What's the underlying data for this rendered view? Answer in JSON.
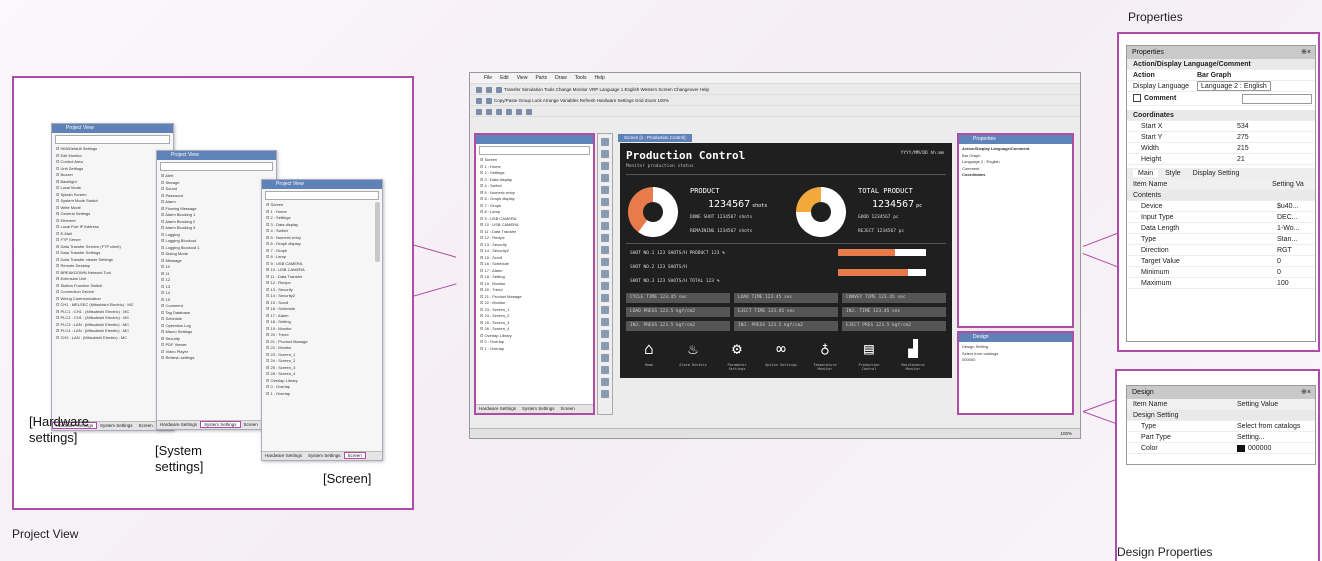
{
  "colors": {
    "accent": "#b04ca8",
    "window_title_bar": "#5f83b8",
    "hmi_background": "#1f1f1f",
    "orange": "#e87b4c",
    "yellow_orange": "#f2a93b"
  },
  "labels": {
    "properties": "Properties",
    "project_view": "Project View",
    "design_properties": "Design Properties",
    "hardware_settings": "[Hardware\nsettings]",
    "system_settings": "[System\nsettings]",
    "screen": "[Screen]"
  },
  "hardware_win": {
    "title": "Project View",
    "items": [
      "HMI/Default Settings",
      "Edit Monitor",
      "Control Area",
      "Unit Settings",
      "Buzzer",
      "Backlight",
      "Local Mode",
      "Splash Screen",
      "System Mode Switch",
      "Write Mode",
      "General Settings",
      "Ethernet",
      "Local Port IP Address",
      "E-Mail",
      "FTP Server",
      "Data Transfer Service (FTP client)",
      "Data Transfer Settings",
      "Data Transfer viewer Settings",
      "Remote Desktop",
      "BREAKDOWN Network Tool",
      "Extension Unit",
      "Station Function Switch",
      "Connection Device",
      "Wiring Communication",
      "CH1 : MELSEC (Mitsubishi Electric) : MC",
      "PLC1 : CH1 : (Mitsubishi Electric) : MC",
      "PLC2 : CH1 : (Mitsubishi Electric) : MC",
      "PLC3 : LAN : (Mitsubishi Electric) : MC",
      "PLC4 : LAN : (Mitsubishi Electric) : MC",
      "CH2 : LAN : (Mitsubishi Electric) : MC"
    ],
    "tabs": [
      "Hardware Settings",
      "System Settings",
      "Screen"
    ]
  },
  "system_win": {
    "title": "Project View",
    "items": [
      "Alert",
      "Storage",
      "Sound",
      "Password",
      "Alarm",
      "Flowing Message",
      "Alarm Blocking 1",
      "Alarm Blocking 2",
      "Alarm Blocking 3",
      "Logging",
      "Logging Blockout",
      "Logging Blockout 1",
      "Dialog Mode",
      "Message",
      "10",
      "11",
      "12",
      "13",
      "14",
      "15",
      "Comment",
      "Tag Database",
      "Schedule",
      "Operation Log",
      "Macro Settings",
      "Security",
      "PDF Viewer",
      "Video Player",
      "Refresh settings"
    ],
    "tabs": [
      "Hardware Settings",
      "System Settings",
      "Screen"
    ]
  },
  "screen_win": {
    "title": "Project View",
    "items": [
      "Screen",
      "1 : Home",
      "2 : Settings",
      "3 : Data display",
      "4 : Switch",
      "5 : Numeric entry",
      "6 : Graph display",
      "7 : Graph",
      "8 : Lamp",
      "9 : USB CAMERA",
      "10 : USB CAMERA",
      "11 : Data Transfer",
      "12 : Recipe",
      "13 : Security",
      "14 : Security2",
      "15 : Scroll",
      "16 : Schedule",
      "17 : Alarm",
      "18 : Setting",
      "19 : Monitor",
      "20 : Trend",
      "21 : Product Manage",
      "22 : Monitor",
      "23 : Screen_1",
      "24 : Screen_2",
      "25 : Screen_3",
      "26 : Screen_4",
      "Overlap Library",
      "0 : Overlap",
      "1 : Overlap"
    ],
    "tabs": [
      "Hardware Settings",
      "System Settings",
      "Screen"
    ]
  },
  "app": {
    "menu": [
      "File",
      "Edit",
      "View",
      "Parts",
      "Draw",
      "Tools",
      "Help"
    ],
    "toolbar1": "Transfer  Simulation  Tools  Change Monitor  VRP  Language 1 English Western  Screen Changeover  Help",
    "toolbar2": "Copy/Paste  Group  Lock  Arrange  Variables  Refresh  Hardware Settings  Grid  Zoom  100%",
    "project_tabs": [
      "Hardware Settings",
      "System Settings",
      "Screen"
    ],
    "screen_tab": "Screen [1 : Production Control]",
    "status_right": "100%"
  },
  "hmi": {
    "title": "Production Control",
    "subtitle": "Monitor production status",
    "timestamp": "YYYY/MM/DD hh:mm",
    "product_label": "PRODUCT",
    "total_label": "TOTAL PRODUCT",
    "product_value": "1234567",
    "product_unit": "shots",
    "total_value": "1234567",
    "total_unit": "pc",
    "small_rows": [
      "DONE SHOT  1234567  shots",
      "REMAINING  1234567  shots",
      "GOOD  1234567  pc",
      "REJECT  1234567  pc"
    ],
    "shot_rows": [
      "SHOT NO.1  123  SHOTS/H  PRODUCT  123 %",
      "SHOT NO.2  123  SHOTS/H",
      "SHOT NO.3  123  SHOTS/H  TOTAL  123 %"
    ],
    "time_cells": [
      "CYCLE TIME  123.45 sec",
      "LOAD TIME  123.45 sec",
      "CONVEY TIME  123.45 sec",
      "LOAD PRESS  123.5 kgf/cm2",
      "EJECT TIME  123.45 sec",
      "INJ. TIME  123.45 sec",
      "INJ. PRESS  123.5 kgf/cm2",
      "INJ. PRESS  123.5 kgf/cm2",
      "EJECT PRES  123.5 kgf/cm2"
    ],
    "product_fraction": 0.6,
    "total_fraction": 0.75,
    "bar1_fraction": 0.65,
    "bar2_fraction": 0.8,
    "nav_icons": [
      "home-icon",
      "alarm-icon",
      "settings-icon",
      "search-icon",
      "temperature-icon",
      "production-icon",
      "factory-icon"
    ],
    "nav_labels": [
      "Home",
      "Alarm History",
      "Parameter Settings",
      "Option Settings",
      "Temperature Monitor",
      "Production Control",
      "Maintenance Monitor"
    ]
  },
  "properties_panel": {
    "title": "Properties",
    "section": "Action/Display Language/Comment",
    "action_label": "Action",
    "action_value": "Bar Graph",
    "display_language_label": "Display Language",
    "display_language_value": "Language 2 : English",
    "comment_label": "Comment",
    "coords_section": "Coordinates",
    "coords": [
      {
        "k": "Start X",
        "v": "534"
      },
      {
        "k": "Start Y",
        "v": "275"
      },
      {
        "k": "Width",
        "v": "215"
      },
      {
        "k": "Height",
        "v": "21"
      }
    ],
    "tabs": [
      "Main",
      "Style",
      "Display Setting"
    ],
    "col_item": "Item Name",
    "col_value": "Setting Va",
    "contents_section": "Contents",
    "rows": [
      {
        "k": "Device",
        "v": "$u40..."
      },
      {
        "k": "Input Type",
        "v": "DEC..."
      },
      {
        "k": "Data Length",
        "v": "1-Wo..."
      },
      {
        "k": "Type",
        "v": "Stan..."
      },
      {
        "k": "Direction",
        "v": "RGT"
      },
      {
        "k": "Target Value",
        "v": "0"
      },
      {
        "k": "Minimum",
        "v": "0"
      },
      {
        "k": "Maximum",
        "v": "100"
      }
    ]
  },
  "design_panel": {
    "title": "Design",
    "col_item": "Item Name",
    "col_value": "Setting Value",
    "section": "Design Setting",
    "rows": [
      {
        "k": "Type",
        "v": "Select from catalogs"
      },
      {
        "k": "Part Type",
        "v": "Setting..."
      },
      {
        "k": "Color",
        "v": "000000"
      }
    ]
  }
}
